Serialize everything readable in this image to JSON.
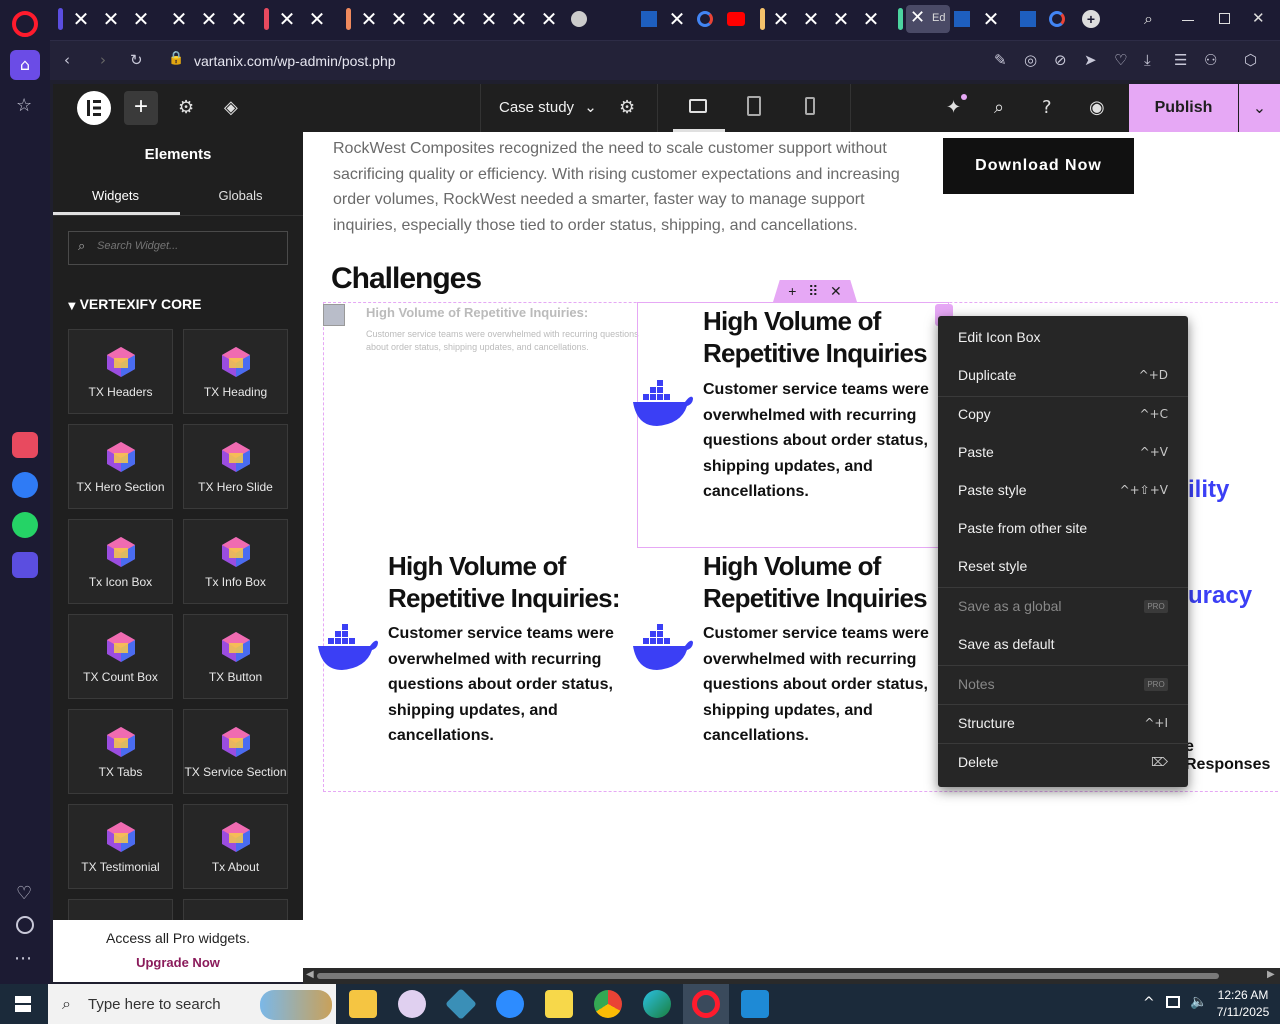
{
  "browser": {
    "url": "vartanix.com/wp-admin/post.php",
    "active_tab_label": "Ed"
  },
  "editor": {
    "page_name": "Case study",
    "publish_label": "Publish"
  },
  "panel": {
    "title": "Elements",
    "tabs": [
      "Widgets",
      "Globals"
    ],
    "search_placeholder": "Search Widget...",
    "category": "VERTEXIFY CORE",
    "widgets": [
      "TX Headers",
      "TX Heading",
      "TX Hero Section",
      "TX Hero Slide",
      "Tx Icon Box",
      "Tx Info Box",
      "TX Count Box",
      "TX Button",
      "TX Tabs",
      "TX Service Section",
      "TX Testimonial",
      "Tx About"
    ],
    "pro_text": "Access all Pro widgets.",
    "pro_link": "Upgrade Now"
  },
  "canvas": {
    "intro": "RockWest Composites recognized the need to scale customer support without sacrificing quality or efficiency. With rising customer expectations and increasing order volumes, RockWest needed a smarter, faster way to manage support inquiries, especially those tied to order status, shipping, and cancellations.",
    "download_label": "Download Now",
    "challenges_heading": "Challenges",
    "ghost_title": "High Volume of Repetitive Inquiries:",
    "ghost_desc": "Customer service teams were overwhelmed with recurring questions about order status, shipping updates, and cancellations.",
    "box_title": "High Volume of Repetitive Inquiries",
    "box_title_colon": "High Volume of Repetitive Inquiries:",
    "box_desc": "Customer service teams were overwhelmed with recurring questions about order status, shipping updates, and cancellations.",
    "fragment_1": "ility",
    "fragment_2": "uracy",
    "fragment_3": "e Responses"
  },
  "context_menu": {
    "items": [
      {
        "label": "Edit Icon Box",
        "shortcut": ""
      },
      {
        "label": "Duplicate",
        "shortcut": "^+D"
      },
      {
        "label": "Copy",
        "shortcut": "^+C"
      },
      {
        "label": "Paste",
        "shortcut": "^+V"
      },
      {
        "label": "Paste style",
        "shortcut": "^+⇧+V"
      },
      {
        "label": "Paste from other site",
        "shortcut": ""
      },
      {
        "label": "Reset style",
        "shortcut": ""
      },
      {
        "label": "Save as a global",
        "shortcut": "PRO"
      },
      {
        "label": "Save as default",
        "shortcut": ""
      },
      {
        "label": "Notes",
        "shortcut": "PRO"
      },
      {
        "label": "Structure",
        "shortcut": "^+I"
      },
      {
        "label": "Delete",
        "shortcut": "⌦"
      }
    ]
  },
  "taskbar": {
    "search_placeholder": "Type here to search",
    "time": "12:26 AM",
    "date": "7/11/2025"
  },
  "colors": {
    "accent_pink": "#e6a8f5",
    "docker_blue": "#3b3ff5",
    "browser_bg": "#1c1b33"
  }
}
